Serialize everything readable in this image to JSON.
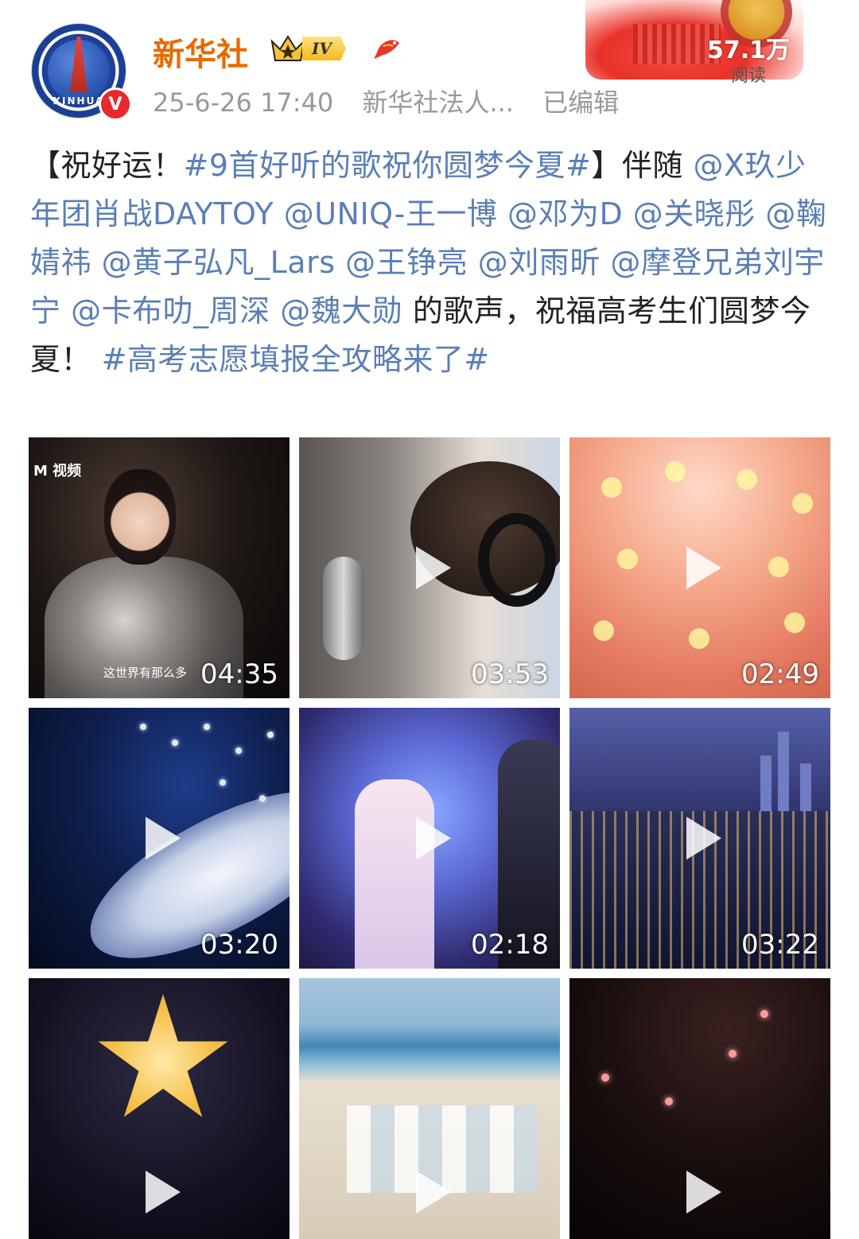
{
  "post": {
    "author": {
      "name": "新华社",
      "avatar_text": "XINHUA",
      "verified_mark": "V",
      "level": "IV"
    },
    "meta": {
      "time": "25-6-26 17:40",
      "source": "新华社法人...",
      "edited": "已编辑"
    },
    "views": {
      "count": "57.1万",
      "label": "阅读"
    },
    "text": {
      "p1": "【祝好运！",
      "tag1": "#9首好听的歌祝你圆梦今夏#",
      "p2": "】伴随 ",
      "mentions": [
        "@X玖少年团肖战DAYTOY",
        "@UNIQ-王一博",
        "@邓为D",
        "@关晓彤",
        "@鞠婧祎",
        "@黄子弘凡_Lars",
        "@王铮亮",
        "@刘雨昕",
        "@摩登兄弟刘宇宁",
        "@卡布叻_周深",
        "@魏大勋"
      ],
      "p3": " 的歌声，祝福高考生们圆梦今夏！ ",
      "tag2": "#高考志愿填报全攻略来了#"
    },
    "videos": [
      {
        "duration": "04:35",
        "caption": "这世界有那么多",
        "logo": "M 视频"
      },
      {
        "duration": "03:53"
      },
      {
        "duration": "02:49"
      },
      {
        "duration": "03:20"
      },
      {
        "duration": "02:18"
      },
      {
        "duration": "03:22"
      },
      {
        "duration": ""
      },
      {
        "duration": ""
      },
      {
        "duration": ""
      }
    ]
  },
  "colors": {
    "username": "#e86a00",
    "link": "#5a7fb5",
    "meta": "#999999",
    "verified": "#e8282d"
  },
  "icons": [
    "crown-icon",
    "koi-icon",
    "play-icon",
    "verified-icon"
  ]
}
